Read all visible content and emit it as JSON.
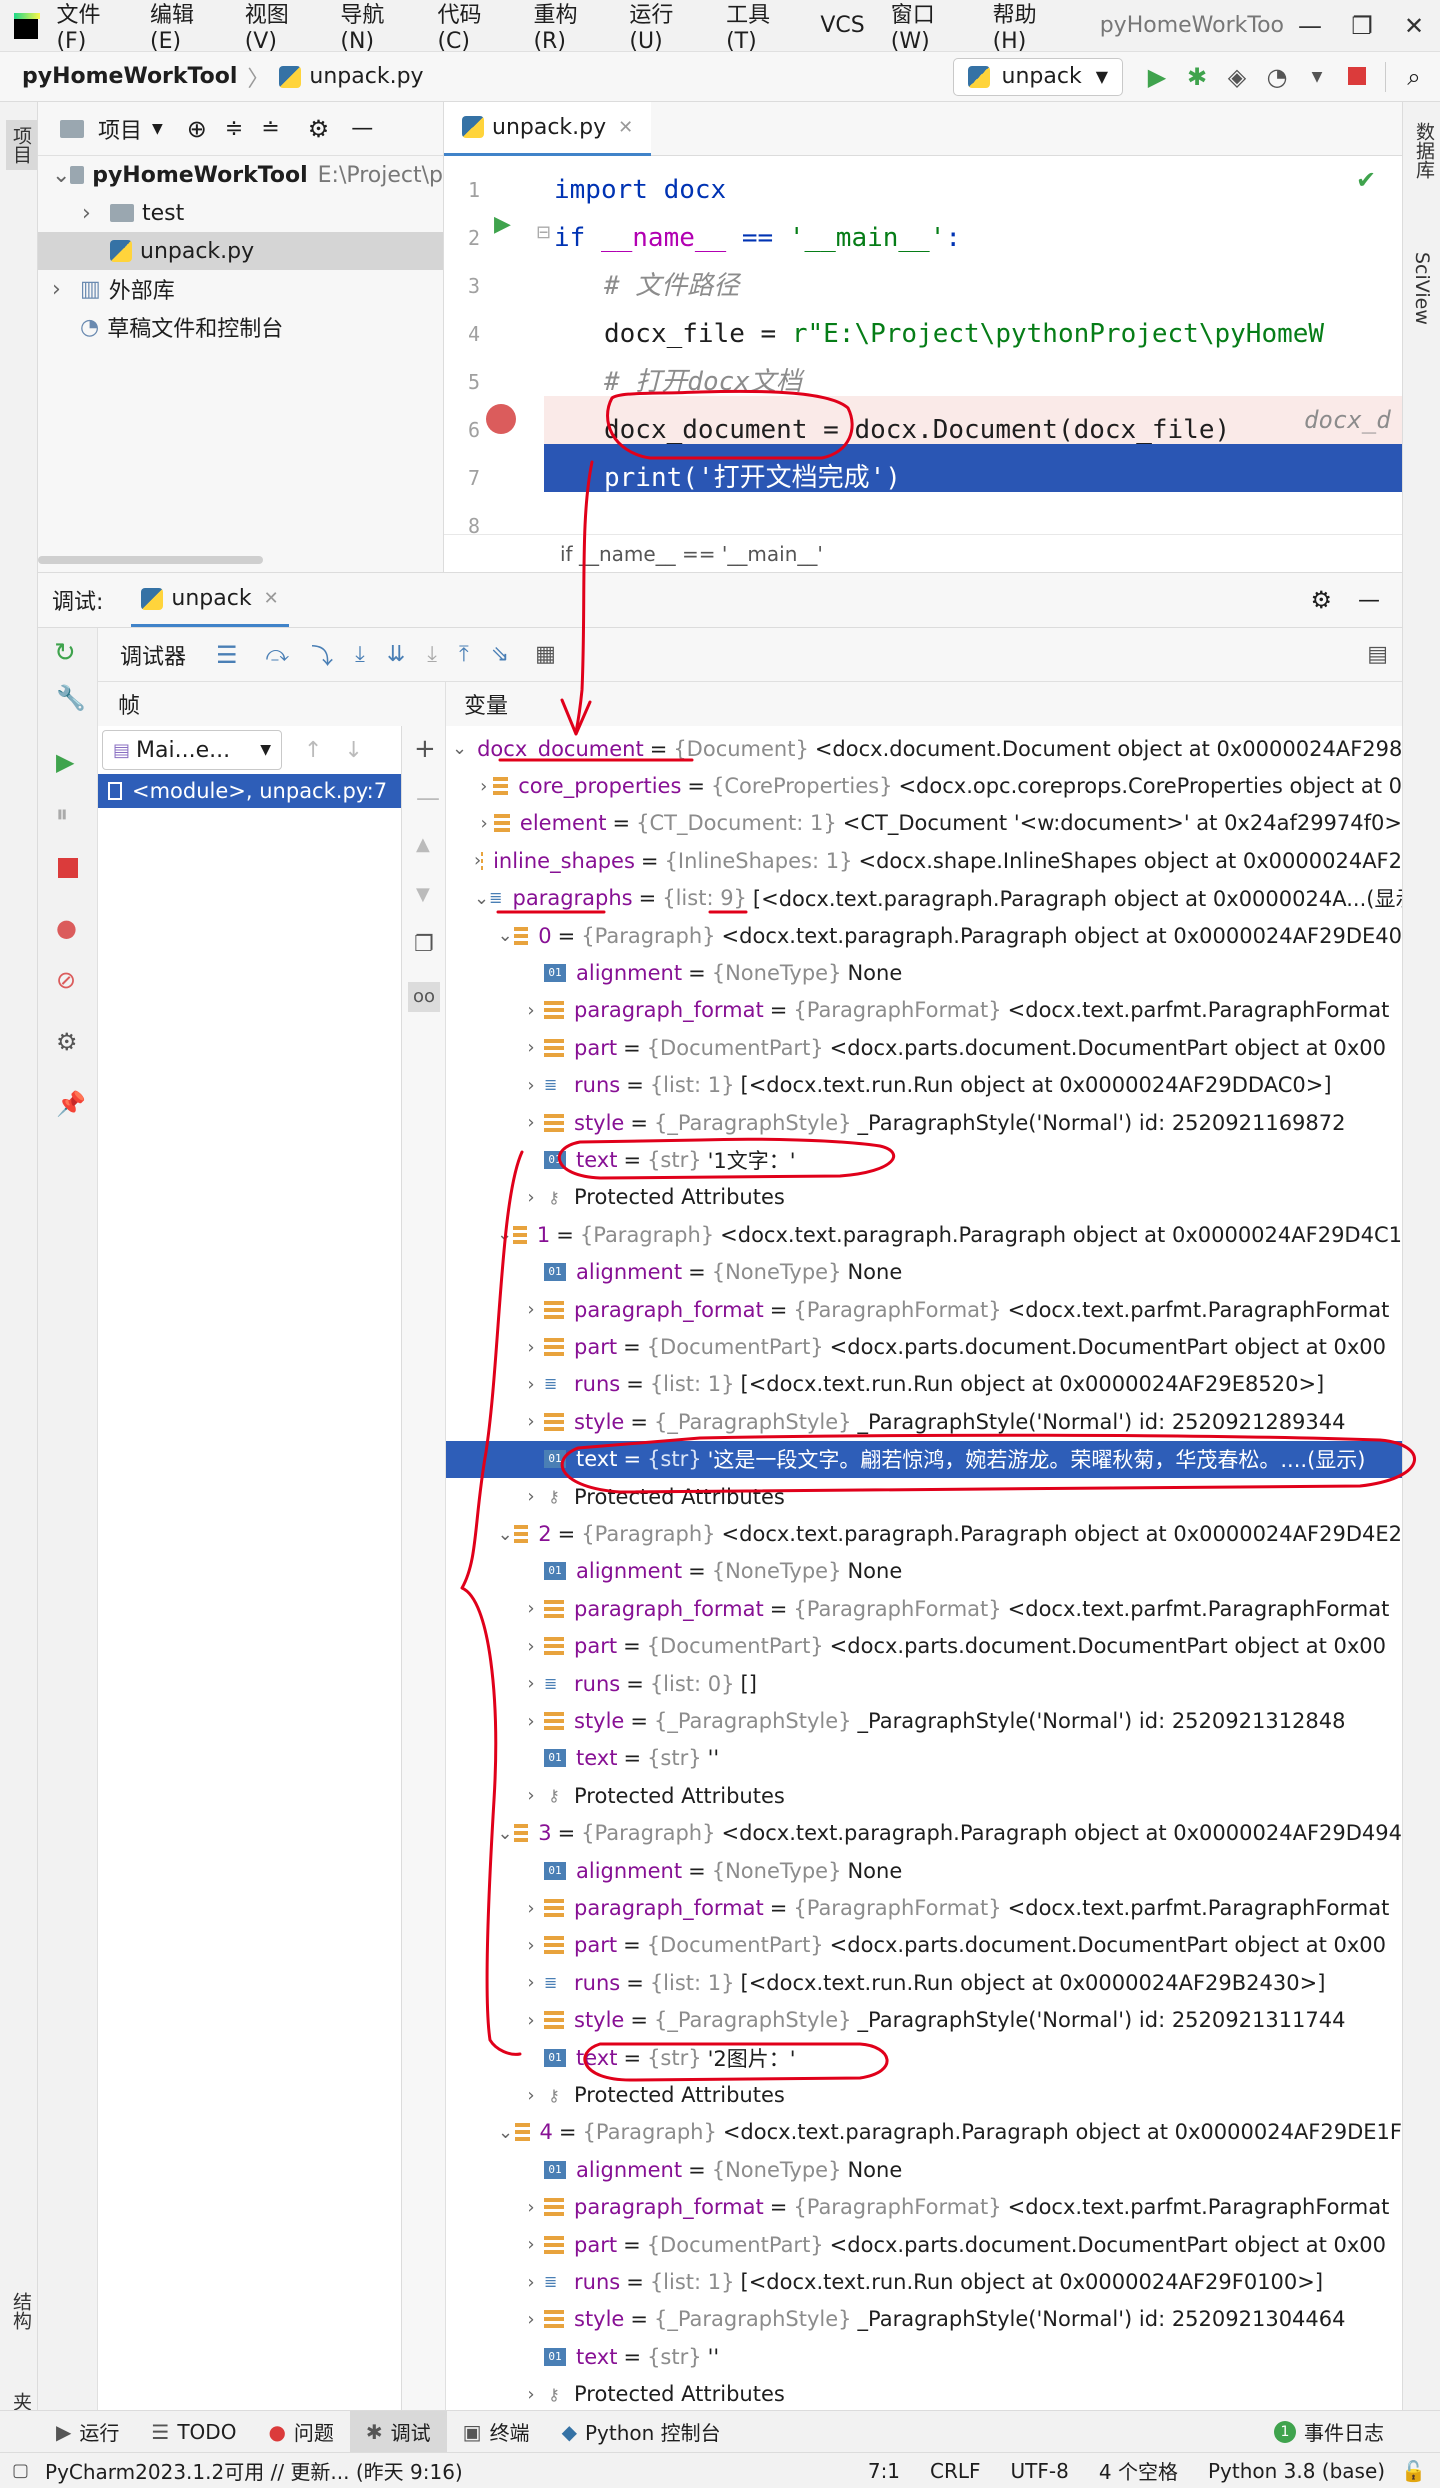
{
  "titlebar": {
    "menu": [
      "文件(F)",
      "编辑(E)",
      "视图(V)",
      "导航(N)",
      "代码(C)",
      "重构(R)",
      "运行(U)",
      "工具(T)",
      "VCS",
      "窗口(W)",
      "帮助(H)"
    ],
    "window_title": "pyHomeWorkToo"
  },
  "navbar": {
    "project": "pyHomeWorkTool",
    "file": "unpack.py",
    "run_config": "unpack"
  },
  "project_panel": {
    "title": "项目",
    "root_name": "pyHomeWorkTool",
    "root_path": "E:\\Project\\p",
    "items": [
      "test",
      "unpack.py",
      "外部库",
      "草稿文件和控制台"
    ]
  },
  "right_strip": [
    "数据库",
    "SciView"
  ],
  "left_strip": [
    "项目",
    "结构",
    "收藏夹"
  ],
  "editor": {
    "tab": "unpack.py",
    "lines": [
      {
        "n": "1",
        "code": "import docx"
      },
      {
        "n": "2",
        "code": "if __name__ == '__main__':"
      },
      {
        "n": "3",
        "code": "# 文件路径"
      },
      {
        "n": "4",
        "code": "docx_file = r\"E:\\Project\\pythonProject\\pyHomeW"
      },
      {
        "n": "5",
        "code": "# 打开docx文档"
      },
      {
        "n": "6",
        "code": "docx_document = docx.Document(docx_file)"
      },
      {
        "n": "7",
        "code": "print('打开文档完成')"
      },
      {
        "n": "8",
        "code": ""
      }
    ],
    "inline_hint": "docx_d",
    "breadcrumb": "if __name__ == '__main__'"
  },
  "debug": {
    "label": "调试:",
    "tab": "unpack",
    "toolbar_label": "调试器",
    "frames_title": "帧",
    "vars_title": "变量",
    "thread": "Mai...e...",
    "frame": "<module>, unpack.py:7"
  },
  "variables": [
    {
      "d": 0,
      "exp": "v",
      "ic": "obj",
      "name": "docx_document",
      "type": "{Document}",
      "val": "<docx.document.Document object at 0x0000024AF298"
    },
    {
      "d": 1,
      "exp": ">",
      "ic": "obj",
      "name": "core_properties",
      "type": "{CoreProperties}",
      "val": "<docx.opc.coreprops.CoreProperties object at 0"
    },
    {
      "d": 1,
      "exp": ">",
      "ic": "obj",
      "name": "element",
      "type": "{CT_Document: 1}",
      "val": "<CT_Document '<w:document>' at 0x24af29974f0>"
    },
    {
      "d": 1,
      "exp": ">",
      "ic": "obj",
      "name": "inline_shapes",
      "type": "{InlineShapes: 1}",
      "val": "<docx.shape.InlineShapes object at 0x0000024AF2"
    },
    {
      "d": 1,
      "exp": "v",
      "ic": "list",
      "name": "paragraphs",
      "type": "{list: 9}",
      "val": "[<docx.text.paragraph.Paragraph object at 0x0000024A...(显示)"
    },
    {
      "d": 2,
      "exp": "v",
      "ic": "obj",
      "name": "0",
      "type": "{Paragraph}",
      "val": "<docx.text.paragraph.Paragraph object at 0x0000024AF29DE40"
    },
    {
      "d": 3,
      "exp": "",
      "ic": "01",
      "name": "alignment",
      "type": "{NoneType}",
      "val": "None"
    },
    {
      "d": 3,
      "exp": ">",
      "ic": "obj",
      "name": "paragraph_format",
      "type": "{ParagraphFormat}",
      "val": "<docx.text.parfmt.ParagraphFormat"
    },
    {
      "d": 3,
      "exp": ">",
      "ic": "obj",
      "name": "part",
      "type": "{DocumentPart}",
      "val": "<docx.parts.document.DocumentPart object at 0x00"
    },
    {
      "d": 3,
      "exp": ">",
      "ic": "list",
      "name": "runs",
      "type": "{list: 1}",
      "val": "[<docx.text.run.Run object at 0x0000024AF29DDAC0>]"
    },
    {
      "d": 3,
      "exp": ">",
      "ic": "obj",
      "name": "style",
      "type": "{_ParagraphStyle}",
      "val": "_ParagraphStyle('Normal') id: 2520921169872"
    },
    {
      "d": 3,
      "exp": "",
      "ic": "01",
      "name": "text",
      "type": "{str}",
      "val": "'1文字：'"
    },
    {
      "d": 3,
      "exp": ">",
      "ic": "key",
      "name": "Protected Attributes",
      "type": "",
      "val": ""
    },
    {
      "d": 2,
      "exp": "v",
      "ic": "obj",
      "name": "1",
      "type": "{Paragraph}",
      "val": "<docx.text.paragraph.Paragraph object at 0x0000024AF29D4C1"
    },
    {
      "d": 3,
      "exp": "",
      "ic": "01",
      "name": "alignment",
      "type": "{NoneType}",
      "val": "None"
    },
    {
      "d": 3,
      "exp": ">",
      "ic": "obj",
      "name": "paragraph_format",
      "type": "{ParagraphFormat}",
      "val": "<docx.text.parfmt.ParagraphFormat"
    },
    {
      "d": 3,
      "exp": ">",
      "ic": "obj",
      "name": "part",
      "type": "{DocumentPart}",
      "val": "<docx.parts.document.DocumentPart object at 0x00"
    },
    {
      "d": 3,
      "exp": ">",
      "ic": "list",
      "name": "runs",
      "type": "{list: 1}",
      "val": "[<docx.text.run.Run object at 0x0000024AF29E8520>]"
    },
    {
      "d": 3,
      "exp": ">",
      "ic": "obj",
      "name": "style",
      "type": "{_ParagraphStyle}",
      "val": "_ParagraphStyle('Normal') id: 2520921289344"
    },
    {
      "d": 3,
      "exp": "",
      "ic": "01",
      "name": "text",
      "type": "{str}",
      "val": "'这是一段文字。翩若惊鸿，婉若游龙。荣曜秋菊，华茂春松。....(显示)",
      "sel": true
    },
    {
      "d": 3,
      "exp": ">",
      "ic": "key",
      "name": "Protected Attributes",
      "type": "",
      "val": ""
    },
    {
      "d": 2,
      "exp": "v",
      "ic": "obj",
      "name": "2",
      "type": "{Paragraph}",
      "val": "<docx.text.paragraph.Paragraph object at 0x0000024AF29D4E2"
    },
    {
      "d": 3,
      "exp": "",
      "ic": "01",
      "name": "alignment",
      "type": "{NoneType}",
      "val": "None"
    },
    {
      "d": 3,
      "exp": ">",
      "ic": "obj",
      "name": "paragraph_format",
      "type": "{ParagraphFormat}",
      "val": "<docx.text.parfmt.ParagraphFormat"
    },
    {
      "d": 3,
      "exp": ">",
      "ic": "obj",
      "name": "part",
      "type": "{DocumentPart}",
      "val": "<docx.parts.document.DocumentPart object at 0x00"
    },
    {
      "d": 3,
      "exp": ">",
      "ic": "list",
      "name": "runs",
      "type": "{list: 0}",
      "val": "[]"
    },
    {
      "d": 3,
      "exp": ">",
      "ic": "obj",
      "name": "style",
      "type": "{_ParagraphStyle}",
      "val": "_ParagraphStyle('Normal') id: 2520921312848"
    },
    {
      "d": 3,
      "exp": "",
      "ic": "01",
      "name": "text",
      "type": "{str}",
      "val": "''"
    },
    {
      "d": 3,
      "exp": ">",
      "ic": "key",
      "name": "Protected Attributes",
      "type": "",
      "val": ""
    },
    {
      "d": 2,
      "exp": "v",
      "ic": "obj",
      "name": "3",
      "type": "{Paragraph}",
      "val": "<docx.text.paragraph.Paragraph object at 0x0000024AF29D494"
    },
    {
      "d": 3,
      "exp": "",
      "ic": "01",
      "name": "alignment",
      "type": "{NoneType}",
      "val": "None"
    },
    {
      "d": 3,
      "exp": ">",
      "ic": "obj",
      "name": "paragraph_format",
      "type": "{ParagraphFormat}",
      "val": "<docx.text.parfmt.ParagraphFormat"
    },
    {
      "d": 3,
      "exp": ">",
      "ic": "obj",
      "name": "part",
      "type": "{DocumentPart}",
      "val": "<docx.parts.document.DocumentPart object at 0x00"
    },
    {
      "d": 3,
      "exp": ">",
      "ic": "list",
      "name": "runs",
      "type": "{list: 1}",
      "val": "[<docx.text.run.Run object at 0x0000024AF29B2430>]"
    },
    {
      "d": 3,
      "exp": ">",
      "ic": "obj",
      "name": "style",
      "type": "{_ParagraphStyle}",
      "val": "_ParagraphStyle('Normal') id: 2520921311744"
    },
    {
      "d": 3,
      "exp": "",
      "ic": "01",
      "name": "text",
      "type": "{str}",
      "val": "'2图片：'"
    },
    {
      "d": 3,
      "exp": ">",
      "ic": "key",
      "name": "Protected Attributes",
      "type": "",
      "val": ""
    },
    {
      "d": 2,
      "exp": "v",
      "ic": "obj",
      "name": "4",
      "type": "{Paragraph}",
      "val": "<docx.text.paragraph.Paragraph object at 0x0000024AF29DE1F"
    },
    {
      "d": 3,
      "exp": "",
      "ic": "01",
      "name": "alignment",
      "type": "{NoneType}",
      "val": "None"
    },
    {
      "d": 3,
      "exp": ">",
      "ic": "obj",
      "name": "paragraph_format",
      "type": "{ParagraphFormat}",
      "val": "<docx.text.parfmt.ParagraphFormat"
    },
    {
      "d": 3,
      "exp": ">",
      "ic": "obj",
      "name": "part",
      "type": "{DocumentPart}",
      "val": "<docx.parts.document.DocumentPart object at 0x00"
    },
    {
      "d": 3,
      "exp": ">",
      "ic": "list",
      "name": "runs",
      "type": "{list: 1}",
      "val": "[<docx.text.run.Run object at 0x0000024AF29F0100>]"
    },
    {
      "d": 3,
      "exp": ">",
      "ic": "obj",
      "name": "style",
      "type": "{_ParagraphStyle}",
      "val": "_ParagraphStyle('Normal') id: 2520921304464"
    },
    {
      "d": 3,
      "exp": "",
      "ic": "01",
      "name": "text",
      "type": "{str}",
      "val": "''"
    },
    {
      "d": 3,
      "exp": ">",
      "ic": "key",
      "name": "Protected Attributes",
      "type": "",
      "val": ""
    }
  ],
  "tool_tabs": [
    "运行",
    "TODO",
    "问题",
    "调试",
    "终端",
    "Python 控制台"
  ],
  "event_log": "事件日志",
  "status": {
    "message": "PyCharm2023.1.2可用 // 更新... (昨天 9:16)",
    "position": "7:1",
    "line_sep": "CRLF",
    "encoding": "UTF-8",
    "indent": "4 个空格",
    "interpreter": "Python 3.8 (base)"
  },
  "colors": {
    "accent": "#2e5eb8",
    "annotation": "#e0001a",
    "breakpoint": "#db5c5c"
  }
}
